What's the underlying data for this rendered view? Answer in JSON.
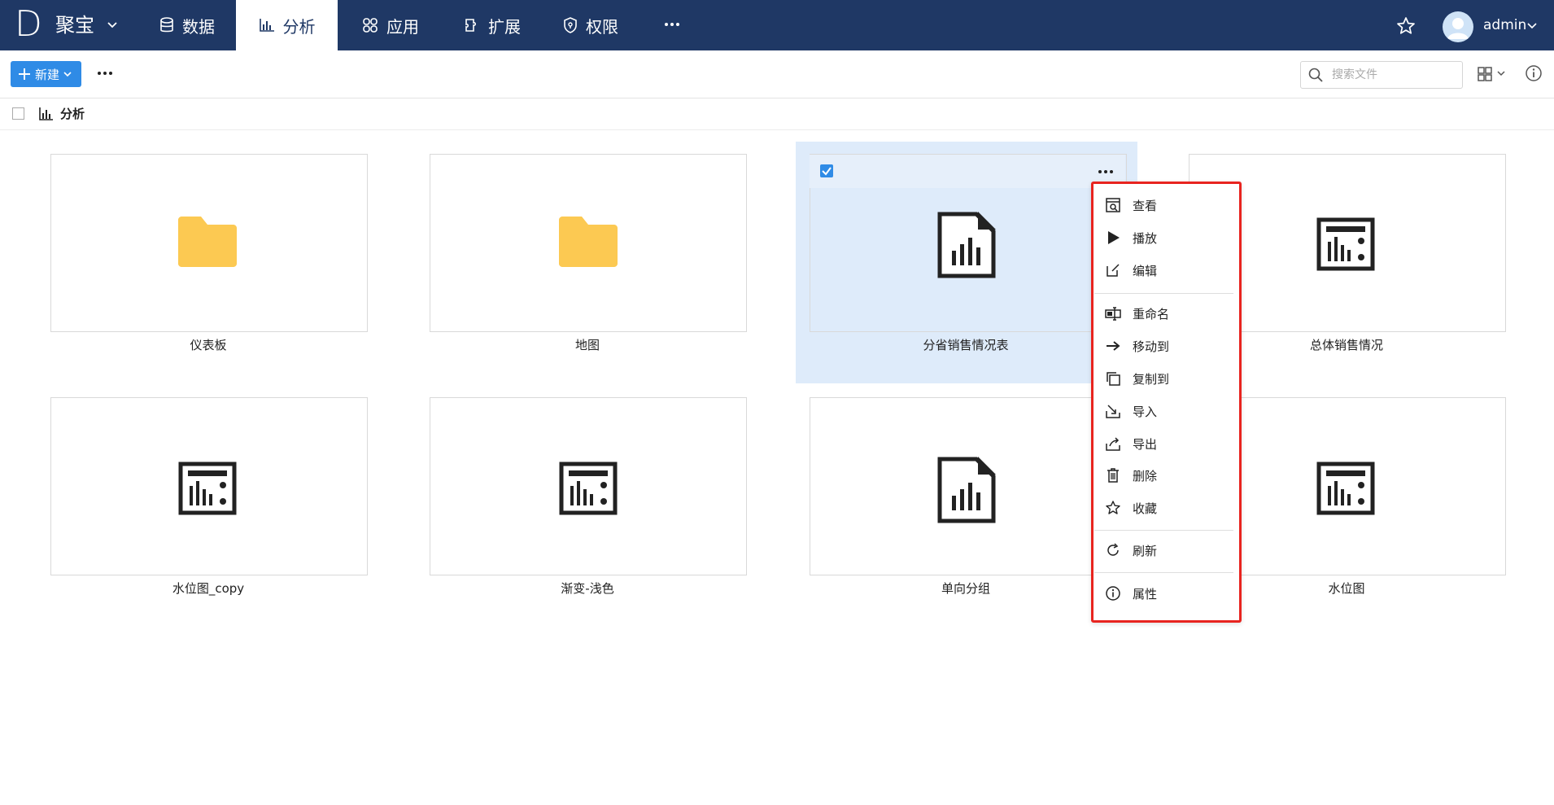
{
  "app": {
    "logo_letter": "D",
    "name": "聚宝"
  },
  "nav": {
    "items": [
      {
        "label": "数据",
        "icon": "database-icon"
      },
      {
        "label": "分析",
        "icon": "bar-chart-icon",
        "active": true
      },
      {
        "label": "应用",
        "icon": "apps-icon"
      },
      {
        "label": "扩展",
        "icon": "extension-icon"
      },
      {
        "label": "权限",
        "icon": "shield-icon"
      }
    ]
  },
  "user": {
    "name": "admin"
  },
  "toolbar": {
    "new_label": "新建",
    "search_placeholder": "搜索文件"
  },
  "breadcrumb": {
    "label": "分析"
  },
  "files": [
    {
      "name": "仪表板",
      "type": "folder"
    },
    {
      "name": "地图",
      "type": "folder"
    },
    {
      "name": "分省销售情况表",
      "type": "report",
      "selected": true
    },
    {
      "name": "总体销售情况",
      "type": "dashboard"
    },
    {
      "name": "水位图_copy",
      "type": "dashboard"
    },
    {
      "name": "渐变-浅色",
      "type": "dashboard"
    },
    {
      "name": "单向分组",
      "type": "report"
    },
    {
      "name": "水位图",
      "type": "dashboard"
    }
  ],
  "context_menu": {
    "items": [
      {
        "label": "查看",
        "icon": "view-icon"
      },
      {
        "label": "播放",
        "icon": "play-icon"
      },
      {
        "label": "编辑",
        "icon": "edit-icon"
      },
      {
        "label": "重命名",
        "icon": "rename-icon"
      },
      {
        "label": "移动到",
        "icon": "arrow-right-icon"
      },
      {
        "label": "复制到",
        "icon": "copy-icon"
      },
      {
        "label": "导入",
        "icon": "import-icon"
      },
      {
        "label": "导出",
        "icon": "export-icon"
      },
      {
        "label": "删除",
        "icon": "trash-icon"
      },
      {
        "label": "收藏",
        "icon": "star-icon"
      },
      {
        "label": "刷新",
        "icon": "refresh-icon"
      },
      {
        "label": "属性",
        "icon": "info-icon"
      }
    ]
  },
  "colors": {
    "topbar": "#1f3865",
    "primary": "#2f8be6",
    "folder": "#fcc952",
    "selection": "#deebfa",
    "menu_border": "#e8241f"
  }
}
